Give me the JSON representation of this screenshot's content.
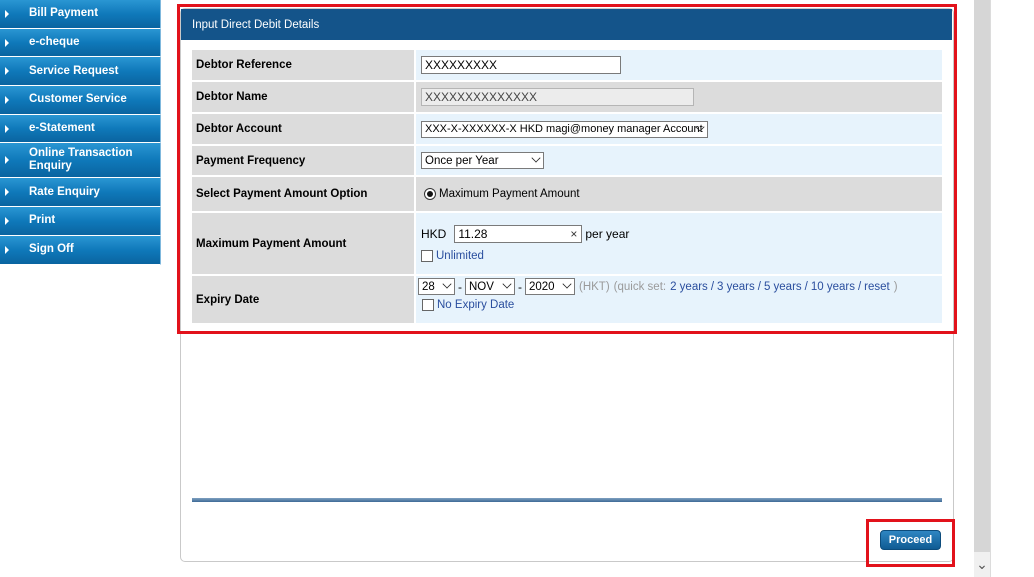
{
  "sidebar": {
    "items": [
      {
        "label": "Bill Payment"
      },
      {
        "label": "e-cheque"
      },
      {
        "label": "Service Request"
      },
      {
        "label": "Customer Service"
      },
      {
        "label": "e-Statement"
      },
      {
        "label": "Online Transaction Enquiry"
      },
      {
        "label": "Rate Enquiry"
      },
      {
        "label": "Print"
      },
      {
        "label": "Sign Off"
      }
    ]
  },
  "form": {
    "title": "Input Direct Debit Details",
    "debtor_reference": {
      "label": "Debtor Reference",
      "value": "XXXXXXXXX"
    },
    "debtor_name": {
      "label": "Debtor Name",
      "value": "XXXXXXXXXXXXXX"
    },
    "debtor_account": {
      "label": "Debtor Account",
      "value": "XXX-X-XXXXXX-X HKD magi@money manager Account"
    },
    "payment_frequency": {
      "label": "Payment Frequency",
      "value": "Once per Year"
    },
    "payment_amount_option": {
      "label": "Select Payment Amount Option",
      "value": "Maximum Payment Amount"
    },
    "max_payment": {
      "label": "Maximum Payment Amount",
      "currency": "HKD",
      "value": "11.28",
      "suffix": "per year",
      "clear_glyph": "×",
      "unlimited_label": "Unlimited"
    },
    "expiry": {
      "label": "Expiry Date",
      "day": "28",
      "month": "NOV",
      "year": "2020",
      "sep": "-",
      "tz": "(HKT)",
      "quick_prefix": "(quick set:",
      "quick_links": [
        "2 years",
        "3 years",
        "5 years",
        "10 years",
        "reset"
      ],
      "quick_sep": "/",
      "quick_suffix": ")",
      "no_expiry_label": "No Expiry Date"
    }
  },
  "actions": {
    "proceed_label": "Proceed"
  },
  "colors": {
    "highlight": "#e2121b",
    "header": "#14548a",
    "sidebar": "#0f79ba"
  }
}
